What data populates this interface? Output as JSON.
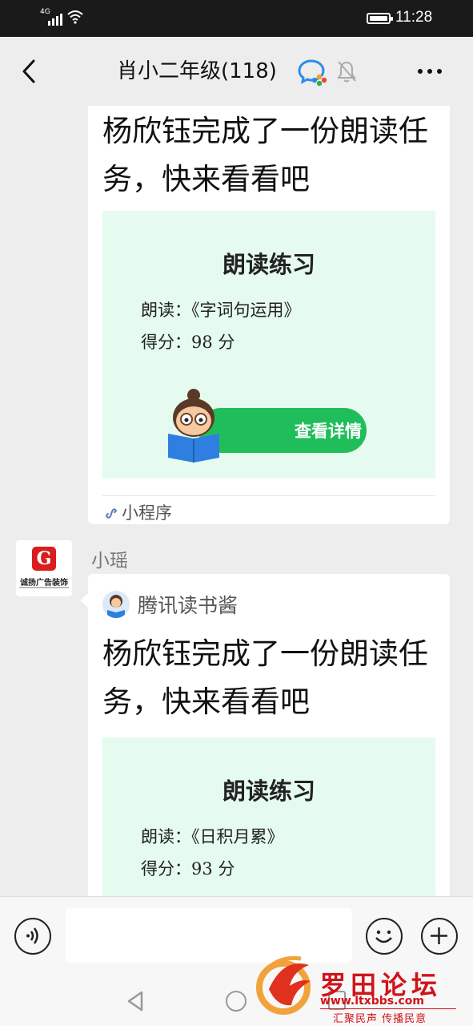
{
  "status_bar": {
    "network": "4G",
    "time": "11:28"
  },
  "header": {
    "title": "肖小二年级(118)"
  },
  "messages": [
    {
      "text": "杨欣钰完成了一份朗读任务，快来看看吧",
      "card": {
        "title": "朗读练习",
        "reading": "朗读：《字词句运用》",
        "score": "得分：98 分",
        "button": "查看详情"
      },
      "footer": "小程序"
    },
    {
      "sender": "小瑶",
      "avatar_text": "诚扬广告装饰",
      "app_name": "腾讯读书酱",
      "text": "杨欣钰完成了一份朗读任务，快来看看吧",
      "card": {
        "title": "朗读练习",
        "reading": "朗读：《日积月累》",
        "score": "得分：93 分"
      }
    }
  ],
  "watermark": {
    "name": "罗田论坛",
    "url": "www.ltxbbs.com",
    "slogan": "汇聚民声  传播民意"
  },
  "colors": {
    "accent_green": "#1fbe5a",
    "card_green": "#e6fbef",
    "watermark_red": "#d0141a"
  }
}
